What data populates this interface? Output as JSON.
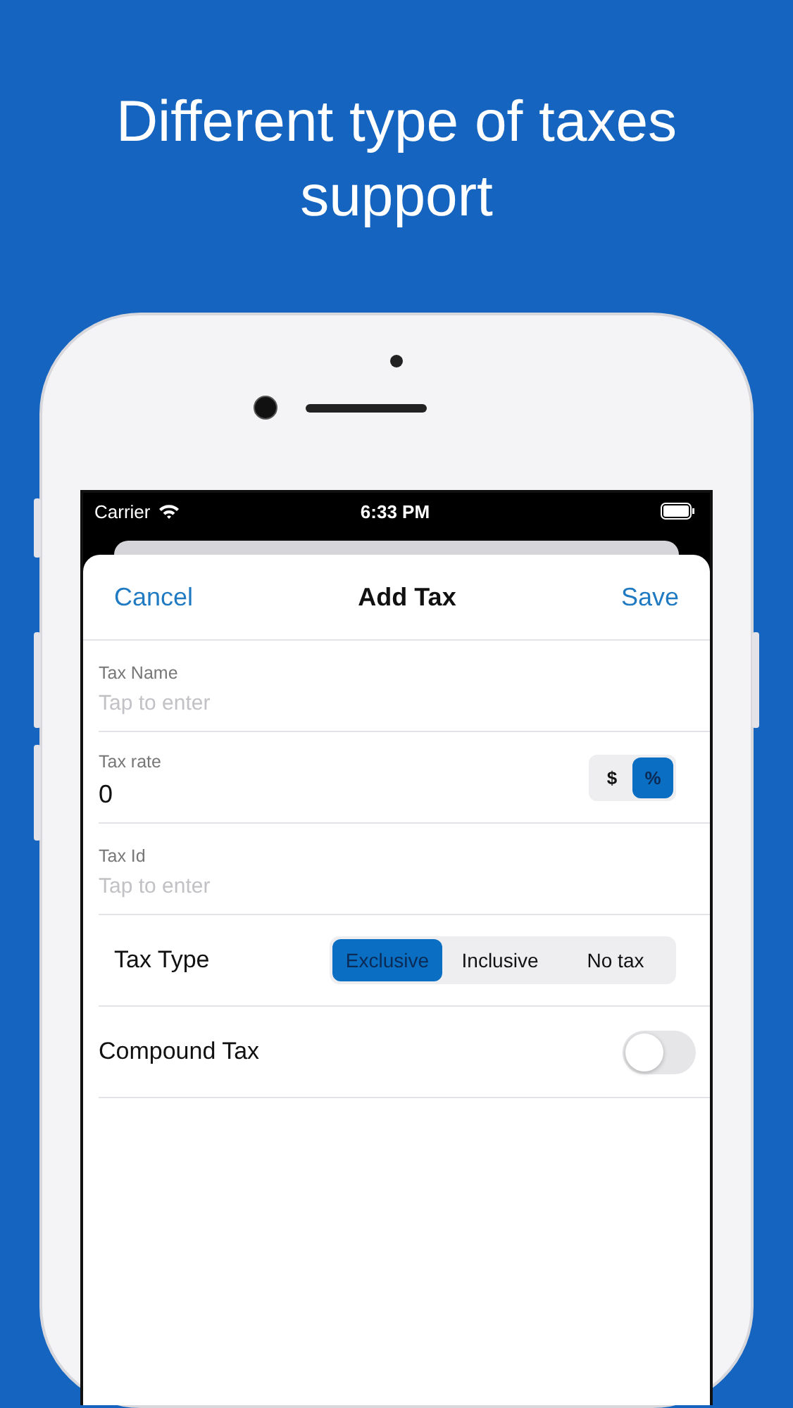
{
  "headline": "Different type of taxes support",
  "status_bar": {
    "carrier": "Carrier",
    "time": "6:33 PM"
  },
  "nav": {
    "cancel": "Cancel",
    "title": "Add Tax",
    "save": "Save"
  },
  "fields": [
    {
      "kind": "text",
      "label": "Tax Name",
      "placeholder": "Tap to enter"
    },
    {
      "kind": "units",
      "label": "Tax rate",
      "value": "0",
      "units": [
        {
          "label": "$",
          "selected": false
        },
        {
          "label": "%",
          "selected": true
        }
      ]
    },
    {
      "kind": "text",
      "label": "Tax Id",
      "placeholder": "Tap to enter"
    }
  ],
  "tax_type": {
    "label": "Tax Type",
    "options": [
      {
        "label": "Exclusive",
        "selected": true
      },
      {
        "label": "Inclusive",
        "selected": false
      },
      {
        "label": "No tax",
        "selected": false
      }
    ]
  },
  "compound": {
    "label": "Compound Tax",
    "on": false
  }
}
